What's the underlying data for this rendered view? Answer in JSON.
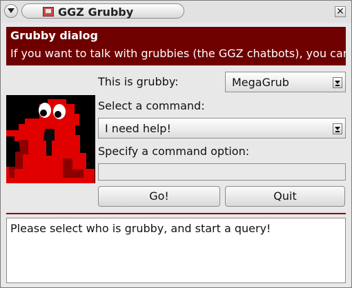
{
  "window": {
    "title": "GGZ Grubby",
    "close_symbol": "✕"
  },
  "header": {
    "title": "Grubby dialog",
    "text": "If you want to talk with grubbies (the GGZ chatbots), you can do so using this dialog."
  },
  "form": {
    "grubby_label": "This is grubby:",
    "grubby_value": "MegaGrub",
    "command_label": "Select a command:",
    "command_value": "I need help!",
    "option_label": "Specify a command option:",
    "option_value": ""
  },
  "buttons": {
    "go": "Go!",
    "quit": "Quit"
  },
  "output": {
    "text": "Please select who is grubby, and start a query!"
  },
  "icons": {
    "window_menu": "chevron-down-icon",
    "app": "grubby-app-icon",
    "close": "close-icon",
    "mascot": "grubby-mascot-icon"
  },
  "colors": {
    "header_bg": "#6e0000",
    "separator": "#8c0000",
    "mascot_red": "#e00000"
  }
}
